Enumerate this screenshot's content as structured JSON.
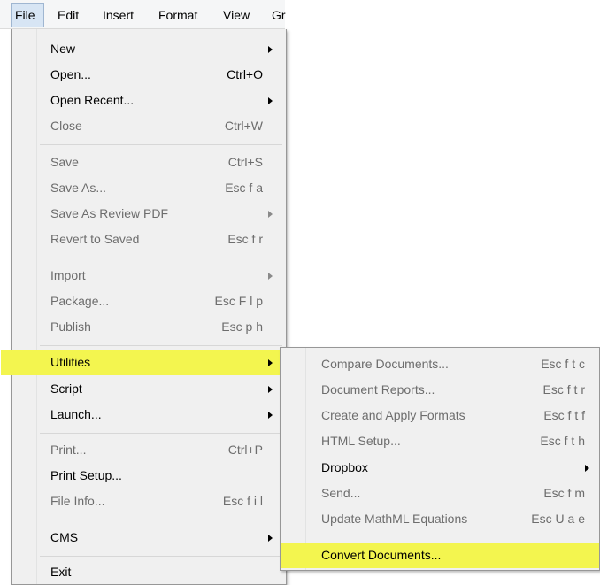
{
  "menubar": [
    "File",
    "Edit",
    "Insert",
    "Format",
    "View",
    "Gr"
  ],
  "file_menu": {
    "items": [
      {
        "label": "New",
        "shortcut": "",
        "submenu": true,
        "disabled": false
      },
      {
        "label": "Open...",
        "shortcut": "Ctrl+O",
        "submenu": false,
        "disabled": false
      },
      {
        "label": "Open Recent...",
        "shortcut": "",
        "submenu": true,
        "disabled": false
      },
      {
        "label": "Close",
        "shortcut": "Ctrl+W",
        "submenu": false,
        "disabled": true
      },
      {
        "label": "Save",
        "shortcut": "Ctrl+S",
        "submenu": false,
        "disabled": true
      },
      {
        "label": "Save As...",
        "shortcut": "Esc f a",
        "submenu": false,
        "disabled": true
      },
      {
        "label": "Save As Review PDF",
        "shortcut": "",
        "submenu": true,
        "disabled": true
      },
      {
        "label": "Revert to Saved",
        "shortcut": "Esc f r",
        "submenu": false,
        "disabled": true
      },
      {
        "label": "Import",
        "shortcut": "",
        "submenu": true,
        "disabled": true
      },
      {
        "label": "Package...",
        "shortcut": "Esc F l p",
        "submenu": false,
        "disabled": true
      },
      {
        "label": "Publish",
        "shortcut": "Esc p h",
        "submenu": false,
        "disabled": true
      },
      {
        "label": "Utilities",
        "shortcut": "",
        "submenu": true,
        "disabled": false
      },
      {
        "label": "Script",
        "shortcut": "",
        "submenu": true,
        "disabled": false
      },
      {
        "label": "Launch...",
        "shortcut": "",
        "submenu": true,
        "disabled": false
      },
      {
        "label": "Print...",
        "shortcut": "Ctrl+P",
        "submenu": false,
        "disabled": true
      },
      {
        "label": "Print Setup...",
        "shortcut": "",
        "submenu": false,
        "disabled": false
      },
      {
        "label": "File Info...",
        "shortcut": "Esc f i l",
        "submenu": false,
        "disabled": true
      },
      {
        "label": "CMS",
        "shortcut": "",
        "submenu": true,
        "disabled": false
      },
      {
        "label": "Exit",
        "shortcut": "",
        "submenu": false,
        "disabled": false
      }
    ]
  },
  "utilities_menu": {
    "items": [
      {
        "label": "Compare Documents...",
        "shortcut": "Esc f t c",
        "submenu": false,
        "disabled": true
      },
      {
        "label": "Document Reports...",
        "shortcut": "Esc f t r",
        "submenu": false,
        "disabled": true
      },
      {
        "label": "Create and Apply Formats",
        "shortcut": "Esc f t f",
        "submenu": false,
        "disabled": true
      },
      {
        "label": "HTML Setup...",
        "shortcut": "Esc f t h",
        "submenu": false,
        "disabled": true
      },
      {
        "label": "Dropbox",
        "shortcut": "",
        "submenu": true,
        "disabled": false
      },
      {
        "label": "Send...",
        "shortcut": "Esc f m",
        "submenu": false,
        "disabled": true
      },
      {
        "label": "Update MathML Equations",
        "shortcut": "Esc U a e",
        "submenu": false,
        "disabled": true
      },
      {
        "label": "Convert Documents...",
        "shortcut": "",
        "submenu": false,
        "disabled": false
      }
    ]
  },
  "colors": {
    "highlight": "#f3f54f",
    "disabled_text": "#6d6d6d",
    "menu_bg": "#f0f0f0"
  }
}
